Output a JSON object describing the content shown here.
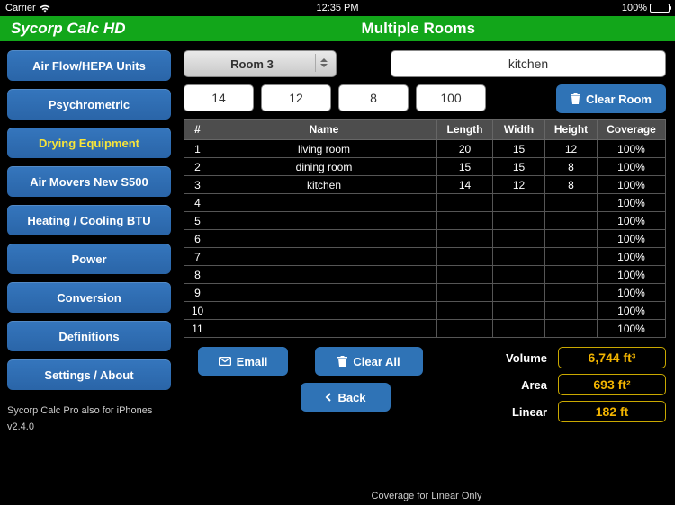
{
  "status": {
    "carrier": "Carrier",
    "time": "12:35 PM",
    "battery": "100%"
  },
  "header": {
    "app": "Sycorp Calc HD",
    "page": "Multiple Rooms"
  },
  "sidebar": {
    "items": [
      "Air Flow/HEPA Units",
      "Psychrometric",
      "Drying Equipment",
      "Air Movers New S500",
      "Heating / Cooling BTU",
      "Power",
      "Conversion",
      "Definitions",
      "Settings / About"
    ],
    "active_index": 2,
    "footer1": "Sycorp Calc Pro also for iPhones",
    "footer2": "v2.4.0"
  },
  "form": {
    "room_select": "Room 3",
    "room_name": "kitchen",
    "length": "14",
    "width": "12",
    "height": "8",
    "coverage": "100",
    "clear_room": "Clear Room"
  },
  "table": {
    "headers": [
      "#",
      "Name",
      "Length",
      "Width",
      "Height",
      "Coverage"
    ],
    "rows": [
      {
        "n": "1",
        "name": "living room",
        "l": "20",
        "w": "15",
        "h": "12",
        "c": "100%"
      },
      {
        "n": "2",
        "name": "dining room",
        "l": "15",
        "w": "15",
        "h": "8",
        "c": "100%"
      },
      {
        "n": "3",
        "name": "kitchen",
        "l": "14",
        "w": "12",
        "h": "8",
        "c": "100%"
      },
      {
        "n": "4",
        "name": "",
        "l": "",
        "w": "",
        "h": "",
        "c": "100%"
      },
      {
        "n": "5",
        "name": "",
        "l": "",
        "w": "",
        "h": "",
        "c": "100%"
      },
      {
        "n": "6",
        "name": "",
        "l": "",
        "w": "",
        "h": "",
        "c": "100%"
      },
      {
        "n": "7",
        "name": "",
        "l": "",
        "w": "",
        "h": "",
        "c": "100%"
      },
      {
        "n": "8",
        "name": "",
        "l": "",
        "w": "",
        "h": "",
        "c": "100%"
      },
      {
        "n": "9",
        "name": "",
        "l": "",
        "w": "",
        "h": "",
        "c": "100%"
      },
      {
        "n": "10",
        "name": "",
        "l": "",
        "w": "",
        "h": "",
        "c": "100%"
      },
      {
        "n": "11",
        "name": "",
        "l": "",
        "w": "",
        "h": "",
        "c": "100%"
      }
    ]
  },
  "actions": {
    "email": "Email",
    "clear_all": "Clear All",
    "back": "Back"
  },
  "results": {
    "volume_label": "Volume",
    "volume": "6,744 ft³",
    "area_label": "Area",
    "area": "693 ft²",
    "linear_label": "Linear",
    "linear": "182 ft"
  },
  "note": "Coverage for Linear Only"
}
